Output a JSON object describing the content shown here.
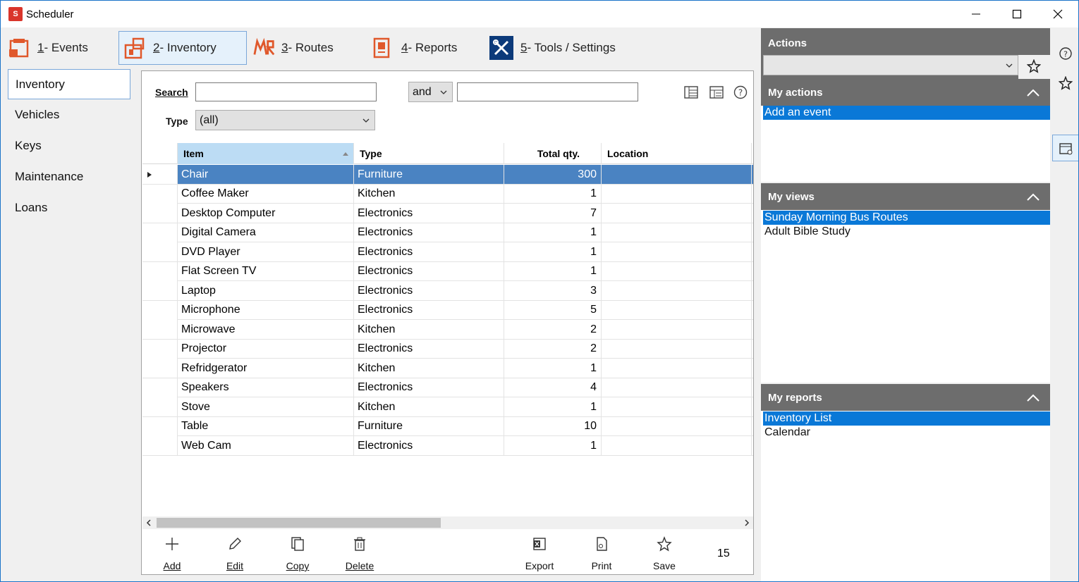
{
  "window": {
    "title": "Scheduler",
    "app_icon_text": "S"
  },
  "tabs": [
    {
      "num": "1",
      "label": " - Events"
    },
    {
      "num": "2",
      "label": " - Inventory"
    },
    {
      "num": "3",
      "label": " - Routes"
    },
    {
      "num": "4",
      "label": " - Reports"
    },
    {
      "num": "5",
      "label": " - Tools / Settings"
    }
  ],
  "nav": [
    "Inventory",
    "Vehicles",
    "Keys",
    "Maintenance",
    "Loans"
  ],
  "search": {
    "search_label": "Search",
    "search_value": "",
    "operator": "and",
    "second_value": "",
    "type_label": "Type",
    "type_value": "(all)"
  },
  "grid": {
    "columns": [
      "Item",
      "Type",
      "Total qty.",
      "Location"
    ],
    "rows": [
      {
        "item": "Chair",
        "type": "Furniture",
        "qty": "300",
        "location": ""
      },
      {
        "item": "Coffee Maker",
        "type": "Kitchen",
        "qty": "1",
        "location": ""
      },
      {
        "item": "Desktop Computer",
        "type": "Electronics",
        "qty": "7",
        "location": ""
      },
      {
        "item": "Digital Camera",
        "type": "Electronics",
        "qty": "1",
        "location": ""
      },
      {
        "item": "DVD Player",
        "type": "Electronics",
        "qty": "1",
        "location": ""
      },
      {
        "item": "Flat Screen TV",
        "type": "Electronics",
        "qty": "1",
        "location": ""
      },
      {
        "item": "Laptop",
        "type": "Electronics",
        "qty": "3",
        "location": ""
      },
      {
        "item": "Microphone",
        "type": "Electronics",
        "qty": "5",
        "location": ""
      },
      {
        "item": "Microwave",
        "type": "Kitchen",
        "qty": "2",
        "location": ""
      },
      {
        "item": "Projector",
        "type": "Electronics",
        "qty": "2",
        "location": ""
      },
      {
        "item": "Refridgerator",
        "type": "Kitchen",
        "qty": "1",
        "location": ""
      },
      {
        "item": "Speakers",
        "type": "Electronics",
        "qty": "4",
        "location": ""
      },
      {
        "item": "Stove",
        "type": "Kitchen",
        "qty": "1",
        "location": ""
      },
      {
        "item": "Table",
        "type": "Furniture",
        "qty": "10",
        "location": ""
      },
      {
        "item": "Web Cam",
        "type": "Electronics",
        "qty": "1",
        "location": ""
      }
    ]
  },
  "toolbar": {
    "add": "Add",
    "edit": "Edit",
    "copy": "Copy",
    "delete": "Delete",
    "export": "Export",
    "print": "Print",
    "save": "Save",
    "count": "15"
  },
  "actions": {
    "title": "Actions",
    "combo_value": "",
    "my_actions_title": "My actions",
    "my_actions": [
      "Add an event"
    ],
    "my_views_title": "My views",
    "my_views": [
      "Sunday Morning Bus Routes",
      "Adult Bible Study"
    ],
    "my_reports_title": "My reports",
    "my_reports": [
      "Inventory List",
      "Calendar"
    ]
  },
  "colors": {
    "selected_row": "#4a83c2",
    "panel_header": "#6d6d6d",
    "list_selection": "#0a78d7",
    "sorted_header": "#bcdcf4"
  }
}
